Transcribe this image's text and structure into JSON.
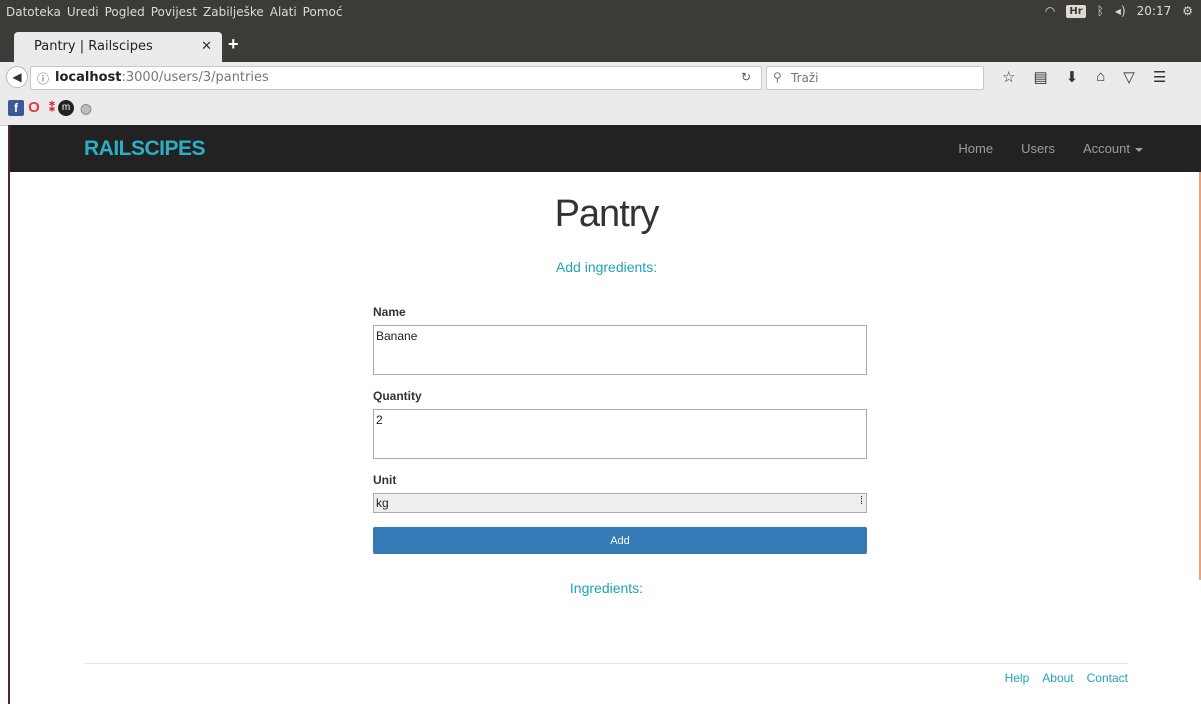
{
  "os": {
    "menu": [
      "Datoteka",
      "Uredi",
      "Pogled",
      "Povijest",
      "Zabilješke",
      "Alati",
      "Pomoć"
    ],
    "keyboard": "Hr",
    "clock": "20:17"
  },
  "browser": {
    "tab_title": "Pantry | Railscipes",
    "url_host": "localhost",
    "url_path": ":3000/users/3/pantries",
    "search_placeholder": "Traži"
  },
  "site": {
    "brand": "RAILSCIPES",
    "nav": {
      "home": "Home",
      "users": "Users",
      "account": "Account"
    }
  },
  "main": {
    "title": "Pantry",
    "add_heading": "Add ingredients:",
    "form": {
      "name_label": "Name",
      "name_value": "Banane",
      "quantity_label": "Quantity",
      "quantity_value": "2",
      "unit_label": "Unit",
      "unit_value": "kg",
      "submit_label": "Add"
    },
    "ingredients_heading": "Ingredients:"
  },
  "footer": {
    "help": "Help",
    "about": "About",
    "contact": "Contact"
  },
  "colors": {
    "brand": "#2ab0c5",
    "primary_button": "#337ab7",
    "navbar": "#222222"
  }
}
